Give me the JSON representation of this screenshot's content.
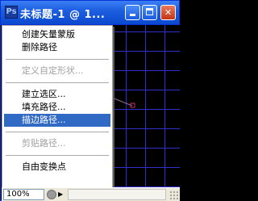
{
  "window": {
    "title": "未标题-1 @ 1..."
  },
  "titlebar_buttons": [
    "minimize",
    "maximize",
    "close"
  ],
  "menu": {
    "groups": [
      [
        {
          "label": "创建矢量蒙版",
          "state": "normal"
        },
        {
          "label": "删除路径",
          "state": "normal"
        }
      ],
      [
        {
          "label": "定义自定形状...",
          "state": "disabled"
        }
      ],
      [
        {
          "label": "建立选区...",
          "state": "normal"
        },
        {
          "label": "填充路径...",
          "state": "normal"
        },
        {
          "label": "描边路径...",
          "state": "highlighted"
        }
      ],
      [
        {
          "label": "剪贴路径...",
          "state": "disabled"
        }
      ],
      [
        {
          "label": "自由变换点",
          "state": "normal"
        }
      ]
    ]
  },
  "statusbar": {
    "zoom": "100%"
  },
  "colors": {
    "titlebar": "#0a49d0",
    "grid": "#2f2fd0",
    "highlight": "#316ac5",
    "path_point": "#c0306a"
  },
  "icons": {
    "app": "photoshop-document-icon",
    "status": "status-info-icon"
  }
}
